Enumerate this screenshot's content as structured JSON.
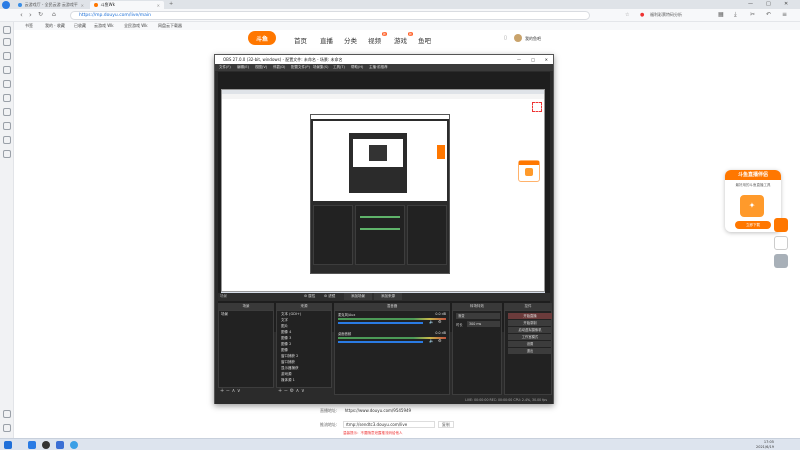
{
  "browser": {
    "tabs": [
      {
        "label": "云游戏厅 - 全民云游 云游戏平台",
        "active": false
      },
      {
        "label": "斗鱼Wk",
        "active": true
      }
    ],
    "url": "https://mp.douyu.com/live/main",
    "hot_search": "福利彩票特码分析",
    "new_tab": "+",
    "win_controls": [
      "—",
      "□",
      "✕"
    ]
  },
  "bookmarks": [
    "书签",
    "我的 · 收藏",
    "已收藏",
    "云游戏 Wk",
    "全民游戏 Wk",
    "网盘云下载器"
  ],
  "douyu": {
    "logo": "斗鱼",
    "nav": [
      "首页",
      "直播",
      "分类",
      "视频",
      "游戏",
      "鱼吧"
    ],
    "nav_badges": {
      "视频": "新",
      "游戏": "新"
    },
    "user": "我的鱼吧"
  },
  "obs": {
    "title": "OBS 27.0.0 (32-bit, windows) - 配置文件: 未命名 - 场景: 未命名",
    "menu": [
      "文件(F)",
      "编辑(E)",
      "视图(V)",
      "停靠(D)",
      "配置文件(P)",
      "场景集(S)",
      "工具(T)",
      "帮助(H)",
      "主播·前推荐"
    ],
    "preview_tabs": [
      "属性",
      "滤镜",
      "添加场景",
      "添加来源"
    ],
    "panels": {
      "scenes": "场景",
      "sources": "来源",
      "mixer": "混音器",
      "transitions": "转场特效",
      "controls": "控件"
    },
    "scene_items": [
      "场景"
    ],
    "sources": [
      "文本 (GDI+)",
      "文字",
      "图片",
      "图像 4",
      "图像 3",
      "图像 2",
      "图像",
      "窗口捕获 2",
      "窗口捕获",
      "显示器捕获",
      "游戏源",
      "媒体源 1"
    ],
    "mixer": {
      "track1_name": "麦克风/Aux",
      "track1_db": "0.0 dB",
      "track2_name": "桌面音频",
      "track2_db": "0.0 dB"
    },
    "transition": {
      "label": "渐变",
      "duration_label": "时长",
      "duration": "300 ms"
    },
    "controls": [
      "开始直播",
      "开始录制",
      "启动虚拟摄像机",
      "工作室模式",
      "设置",
      "退出"
    ],
    "status": "LIVE: 00:00:00    REC: 00:00:00    CPU: 2.4%, 30.00 fps"
  },
  "ad": {
    "title": "斗鱼直播伴侣",
    "sub": "最好用的斗鱼直播工具",
    "button": "立即下载"
  },
  "page_info": {
    "stream_addr_label": "直播地址:",
    "stream_addr": "https://www.douyu.com/9545949",
    "push_label": "推流地址:",
    "push_addr": "rtmp://sendtc3.douyu.com/live",
    "push_btn": "复制",
    "warning": "温馨提示：不要随意泄露推流码给他人"
  },
  "taskbar": {
    "time": "17:05",
    "date": "2021/6/19"
  },
  "colors": {
    "accent": "#ff7700",
    "url": "#1a6ed8",
    "obs_bg": "#2b2b2b"
  }
}
